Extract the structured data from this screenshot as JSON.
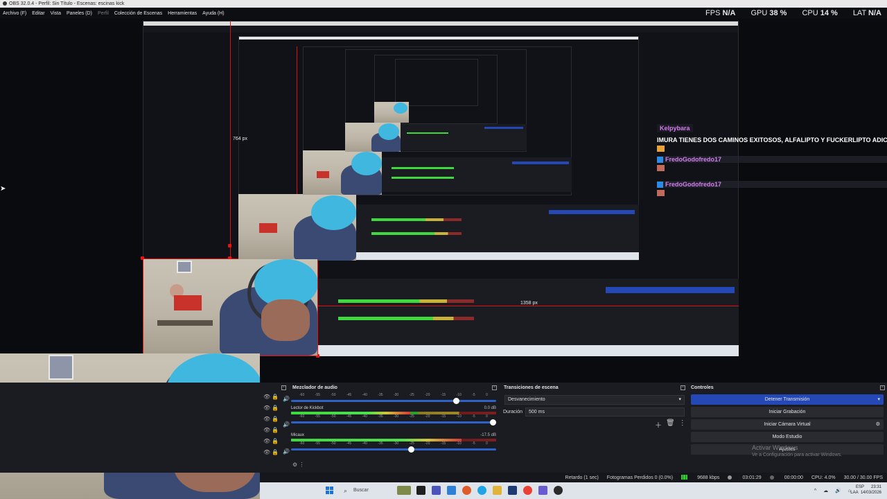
{
  "window": {
    "title": "OBS 32.0.4 - Perfil: Sin Título - Escenas: escinas kick"
  },
  "menu": [
    {
      "label": "Archivo (F)",
      "enabled": true
    },
    {
      "label": "Editar",
      "enabled": true
    },
    {
      "label": "Vista",
      "enabled": true
    },
    {
      "label": "Paneles (D)",
      "enabled": true
    },
    {
      "label": "Perfil",
      "enabled": false
    },
    {
      "label": "Colección de Escenas",
      "enabled": true
    },
    {
      "label": "Herramientas",
      "enabled": true
    },
    {
      "label": "Ayuda (H)",
      "enabled": true
    }
  ],
  "stats": {
    "fps_label": "FPS",
    "fps_value": "N/A",
    "gpu_label": "GPU",
    "gpu_value": "38 %",
    "cpu_label": "CPU",
    "cpu_value": "14 %",
    "lat_label": "LAT",
    "lat_value": "N/A"
  },
  "preview": {
    "measure_1": "764 px",
    "measure_2": "1358 px"
  },
  "chat": {
    "user": "Kelpybara",
    "message": "IMURA TIENES DOS CAMINOS EXITOSOS, ALFALIPTO Y FUCKERLIPTO ADICTO AL",
    "messages": [
      {
        "user": "FredoGodofredo17"
      },
      {
        "user": "FredoGodofredo17"
      }
    ]
  },
  "mixer": {
    "title": "Mezclador de audio",
    "scale": [
      "-60",
      "-55",
      "-50",
      "-45",
      "-40",
      "-35",
      "-30",
      "-25",
      "-20",
      "-15",
      "-10",
      "-5",
      "0"
    ],
    "channels": [
      {
        "name": "",
        "db": "",
        "level": 0,
        "volume": 0.82
      },
      {
        "name": "Lector de Kickbot",
        "db": "0.0 dB",
        "level": 0.58,
        "volume": 1.0
      },
      {
        "name": "Micaux",
        "db": "-17.5 dB",
        "level": 0.83,
        "volume": 0.6
      }
    ]
  },
  "transitions": {
    "title": "Transiciones de escena",
    "selected": "Desvanecimiento",
    "duration_label": "Duración",
    "duration_value": "500 ms"
  },
  "controls": {
    "title": "Controles",
    "stop_stream": "Detener Transmisión",
    "start_record": "Iniciar Grabación",
    "start_virtualcam": "Iniciar Cámara Virtual",
    "studio_mode": "Modo Estudio",
    "settings": "Ajustes"
  },
  "watermark": {
    "line1": "Activar Windows",
    "line2": "Ve a Configuración para activar Windows."
  },
  "status": {
    "replay": "Retardo (1 sec)",
    "dropped": "Fotogramas Perdidos 0 (0.0%)",
    "bitrate": "9688 kbps",
    "stream_time": "03:01:29",
    "rec_time": "00:00:00",
    "cpu": "CPU: 4.0%",
    "fps": "30.00 / 30.00 FPS"
  },
  "taskbar": {
    "search": "Buscar",
    "lang": "ESP",
    "lang2": "LAA",
    "time": "23:31",
    "date": "14/03/2026"
  }
}
